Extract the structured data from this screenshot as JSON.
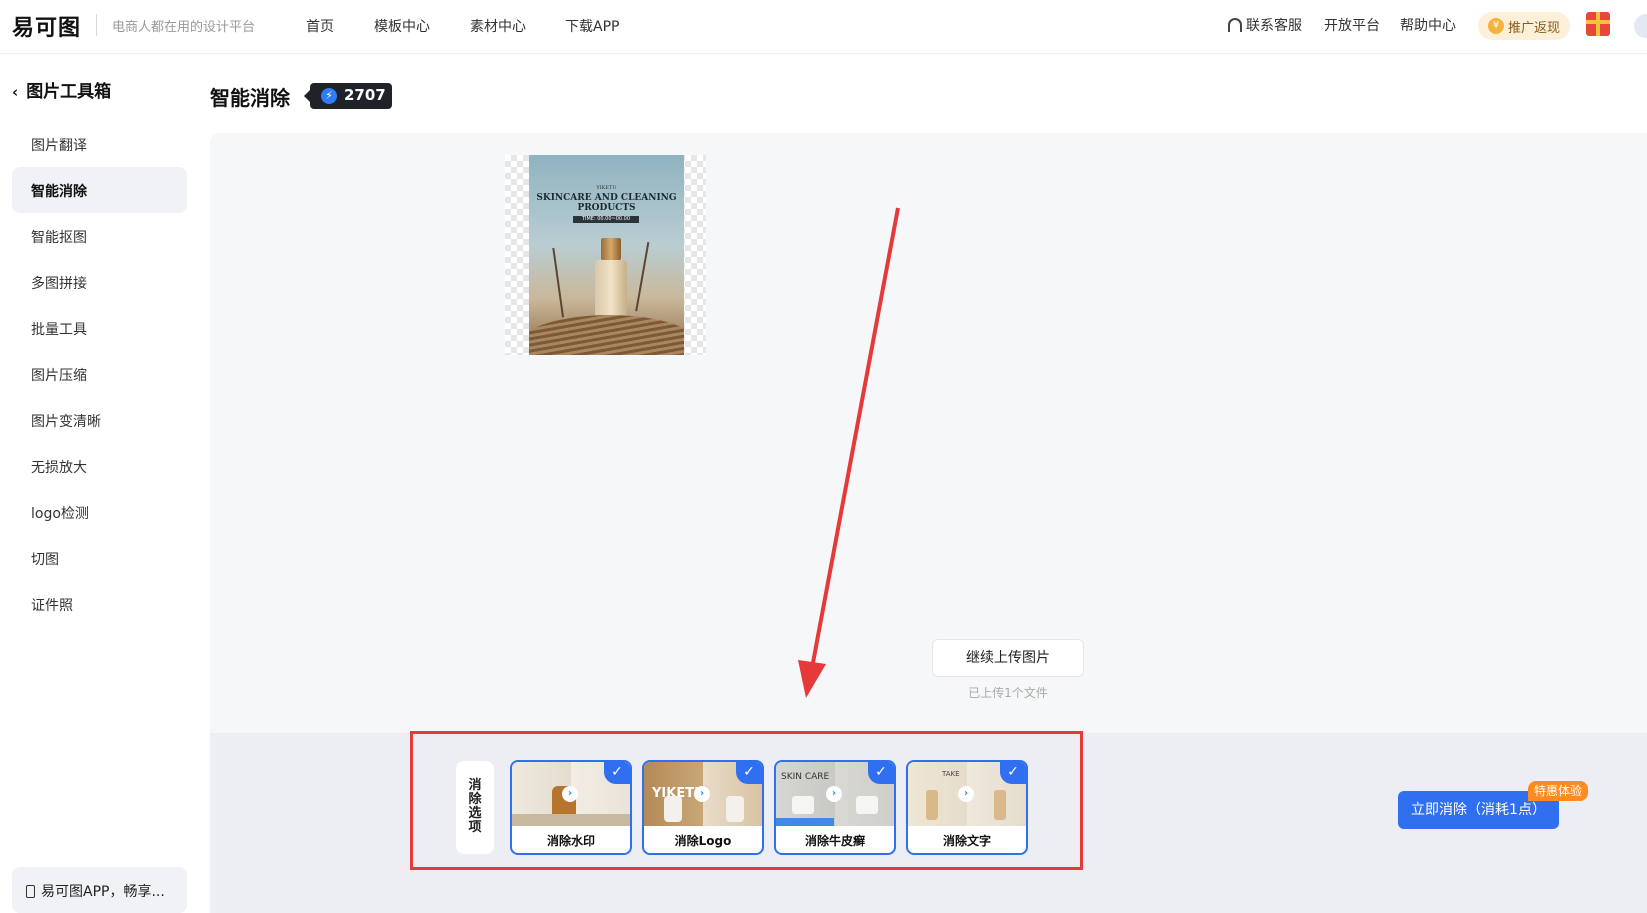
{
  "header": {
    "logo": "易可图",
    "slogan": "电商人都在用的设计平台",
    "nav": [
      "首页",
      "模板中心",
      "素材中心",
      "下载APP"
    ],
    "service": "联系客服",
    "open_platform": "开放平台",
    "help": "帮助中心",
    "promo": "推广返现"
  },
  "sidebar": {
    "title": "图片工具箱",
    "items": [
      "图片翻译",
      "智能消除",
      "智能抠图",
      "多图拼接",
      "批量工具",
      "图片压缩",
      "图片变清晰",
      "无损放大",
      "logo检测",
      "切图",
      "证件照"
    ],
    "active": "智能消除",
    "app_banner": "易可图APP，畅享..."
  },
  "main": {
    "title": "智能消除",
    "credits": "2707",
    "preview": {
      "brand": "YIKETU",
      "headline": "SKINCARE AND CLEANING PRODUCTS",
      "time": "TIME: 00.00~00.00"
    },
    "upload_button": "继续上传图片",
    "upload_info": "已上传1个文件"
  },
  "options": {
    "label": "消除选项",
    "items": [
      {
        "label": "消除水印",
        "checked": true
      },
      {
        "label": "消除Logo",
        "checked": true,
        "thumb_text": "YIKETU"
      },
      {
        "label": "消除牛皮癣",
        "checked": true,
        "thumb_text": "SKIN CARE"
      },
      {
        "label": "消除文字",
        "checked": true,
        "thumb_text": "TAKE"
      }
    ]
  },
  "action": {
    "button": "立即消除（消耗1点）",
    "badge": "特惠体验"
  },
  "colors": {
    "primary": "#2f6ff0",
    "highlight": "#e63939",
    "badge": "#ff8a1f"
  }
}
